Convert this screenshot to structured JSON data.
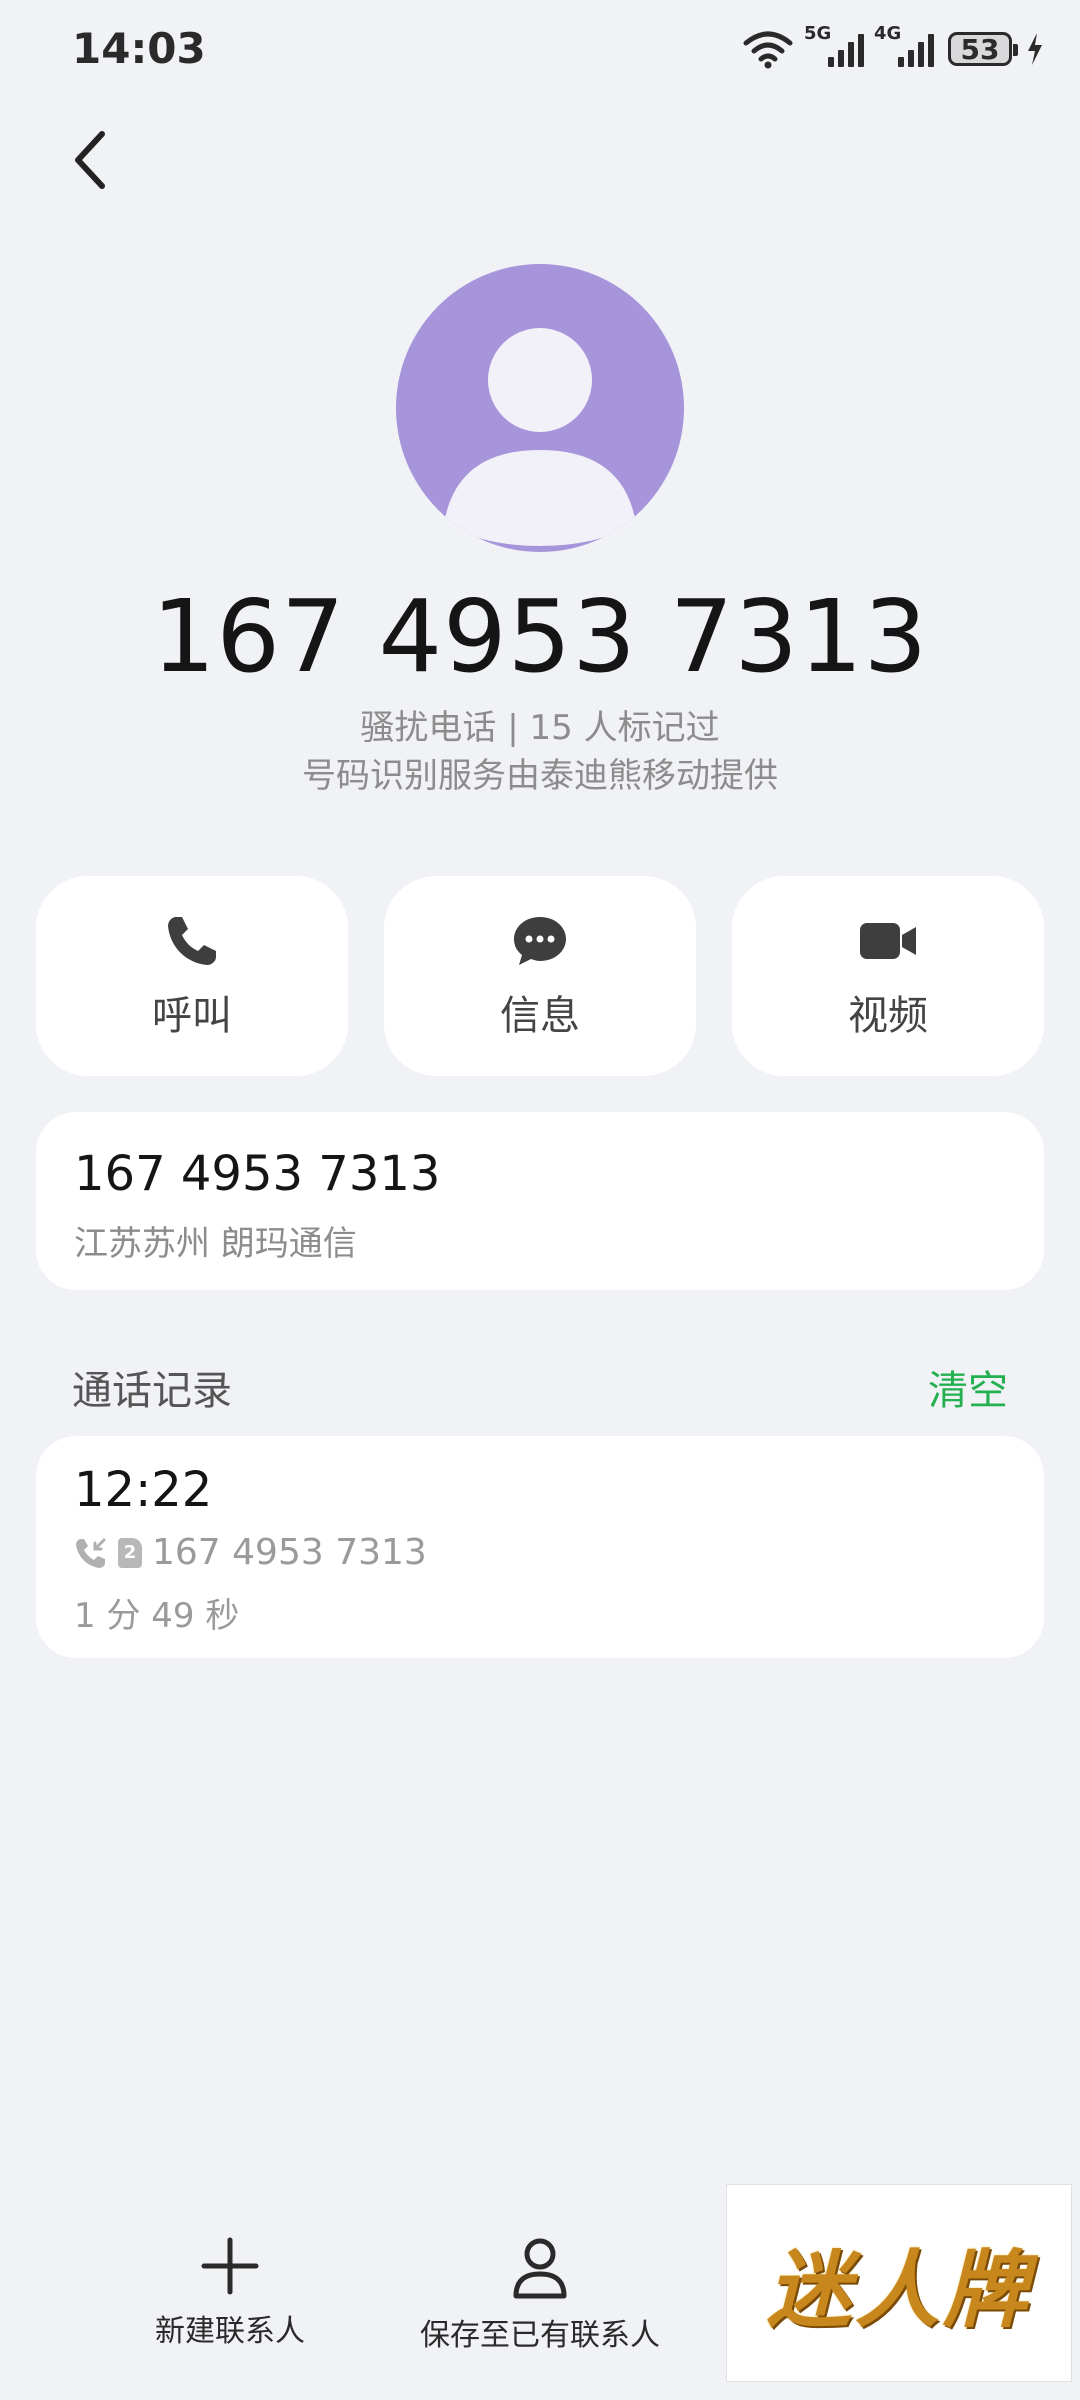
{
  "status_bar": {
    "time": "14:03",
    "net1": "5G",
    "net2": "4G",
    "battery": "53"
  },
  "contact": {
    "number": "167 4953 7313",
    "tag_line": "骚扰电话 | 15 人标记过",
    "provider_line": "号码识别服务由泰迪熊移动提供"
  },
  "actions": [
    {
      "label": "呼叫",
      "icon": "phone-icon"
    },
    {
      "label": "信息",
      "icon": "message-icon"
    },
    {
      "label": "视频",
      "icon": "video-icon"
    }
  ],
  "number_card": {
    "number": "167 4953 7313",
    "location": "江苏苏州 朗玛通信"
  },
  "call_log": {
    "title": "通话记录",
    "clear_label": "清空",
    "entries": [
      {
        "time": "12:22",
        "sim": "2",
        "number": "167 4953 7313",
        "duration": "1 分 49 秒"
      }
    ]
  },
  "bottom_bar": {
    "new_contact": "新建联系人",
    "save_existing": "保存至已有联系人"
  },
  "watermark": {
    "text": "迷人牌"
  },
  "colors": {
    "accent_green": "#24b050",
    "avatar": "#a795db",
    "background": "#f1f2f6"
  }
}
